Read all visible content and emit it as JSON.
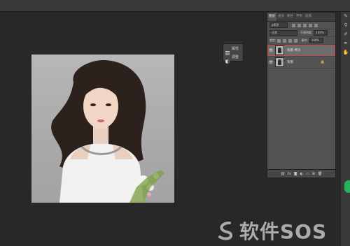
{
  "panel": {
    "tabs": [
      "图层",
      "通道",
      "路径",
      "字符",
      "段落"
    ],
    "filter_label": "ρ类型",
    "blend_mode": "正常",
    "opacity_label": "不透明度:",
    "opacity_value": "100%",
    "lock_label": "锁定:",
    "fill_label": "填充:",
    "fill_value": "100%",
    "layers": [
      {
        "name": "背景 拷贝",
        "selected": true,
        "locked": false
      },
      {
        "name": "背景",
        "selected": false,
        "locked": true
      }
    ]
  },
  "mini_panel": {
    "items": [
      {
        "label": "属性",
        "icon": "properties-icon"
      },
      {
        "label": "调整",
        "icon": "adjustments-icon"
      }
    ]
  },
  "watermark": {
    "text": "软件SOS"
  },
  "colors": {
    "accent_selection": "#c64a4a",
    "green_button": "#27b35a"
  }
}
